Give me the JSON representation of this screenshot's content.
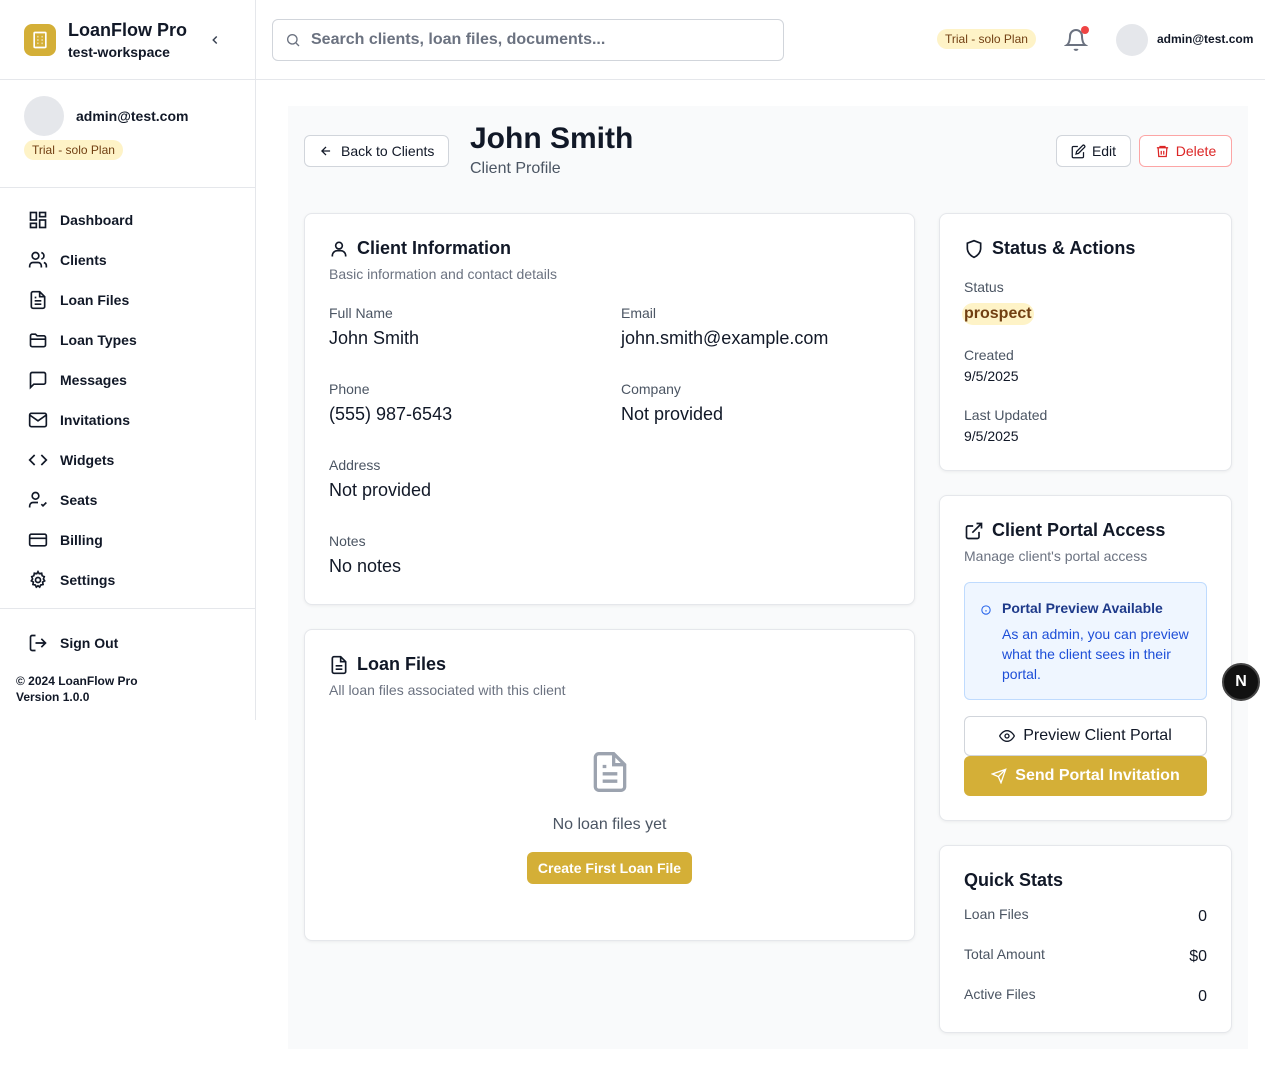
{
  "brand": {
    "title": "LoanFlow Pro",
    "workspace": "test-workspace"
  },
  "user": {
    "email": "admin@test.com",
    "plan_badge": "Trial - solo Plan"
  },
  "nav": {
    "items": [
      {
        "label": "Dashboard",
        "icon": "dashboard-icon"
      },
      {
        "label": "Clients",
        "icon": "users-icon"
      },
      {
        "label": "Loan Files",
        "icon": "file-icon"
      },
      {
        "label": "Loan Types",
        "icon": "folder-icon"
      },
      {
        "label": "Messages",
        "icon": "message-icon"
      },
      {
        "label": "Invitations",
        "icon": "mail-icon"
      },
      {
        "label": "Widgets",
        "icon": "code-icon"
      },
      {
        "label": "Seats",
        "icon": "user-check-icon"
      },
      {
        "label": "Billing",
        "icon": "credit-card-icon"
      },
      {
        "label": "Settings",
        "icon": "gear-icon"
      }
    ],
    "sign_out": "Sign Out"
  },
  "footer": {
    "copyright": "© 2024 LoanFlow Pro",
    "version": "Version 1.0.0"
  },
  "search": {
    "placeholder": "Search clients, loan files, documents..."
  },
  "header": {
    "back": "Back to Clients",
    "title": "John Smith",
    "subtitle": "Client Profile",
    "edit": "Edit",
    "delete": "Delete"
  },
  "client_info": {
    "title": "Client Information",
    "desc": "Basic information and contact details",
    "fields": [
      {
        "label": "Full Name",
        "value": "John Smith"
      },
      {
        "label": "Email",
        "value": "john.smith@example.com"
      },
      {
        "label": "Phone",
        "value": "(555) 987-6543"
      },
      {
        "label": "Company",
        "value": "Not provided"
      },
      {
        "label": "Address",
        "value": "Not provided"
      },
      {
        "label": "Notes",
        "value": "No notes"
      }
    ]
  },
  "loan_files": {
    "title": "Loan Files",
    "desc": "All loan files associated with this client",
    "empty": "No loan files yet",
    "create": "Create First Loan File"
  },
  "status": {
    "title": "Status & Actions",
    "status_label": "Status",
    "status_value": "prospect",
    "created_label": "Created",
    "created_value": "9/5/2025",
    "updated_label": "Last Updated",
    "updated_value": "9/5/2025"
  },
  "portal": {
    "title": "Client Portal Access",
    "desc": "Manage client's portal access",
    "info_title": "Portal Preview Available",
    "info_text": "As an admin, you can preview what the client sees in their portal.",
    "preview": "Preview Client Portal",
    "send": "Send Portal Invitation"
  },
  "stats": {
    "title": "Quick Stats",
    "rows": [
      {
        "label": "Loan Files",
        "value": "0"
      },
      {
        "label": "Total Amount",
        "value": "$0"
      },
      {
        "label": "Active Files",
        "value": "0"
      }
    ]
  },
  "dev_badge": "N",
  "colors": {
    "accent": "#d4af37",
    "danger": "#dc2626",
    "badge_bg": "#fef3c7",
    "info_bg": "#eff6ff"
  }
}
